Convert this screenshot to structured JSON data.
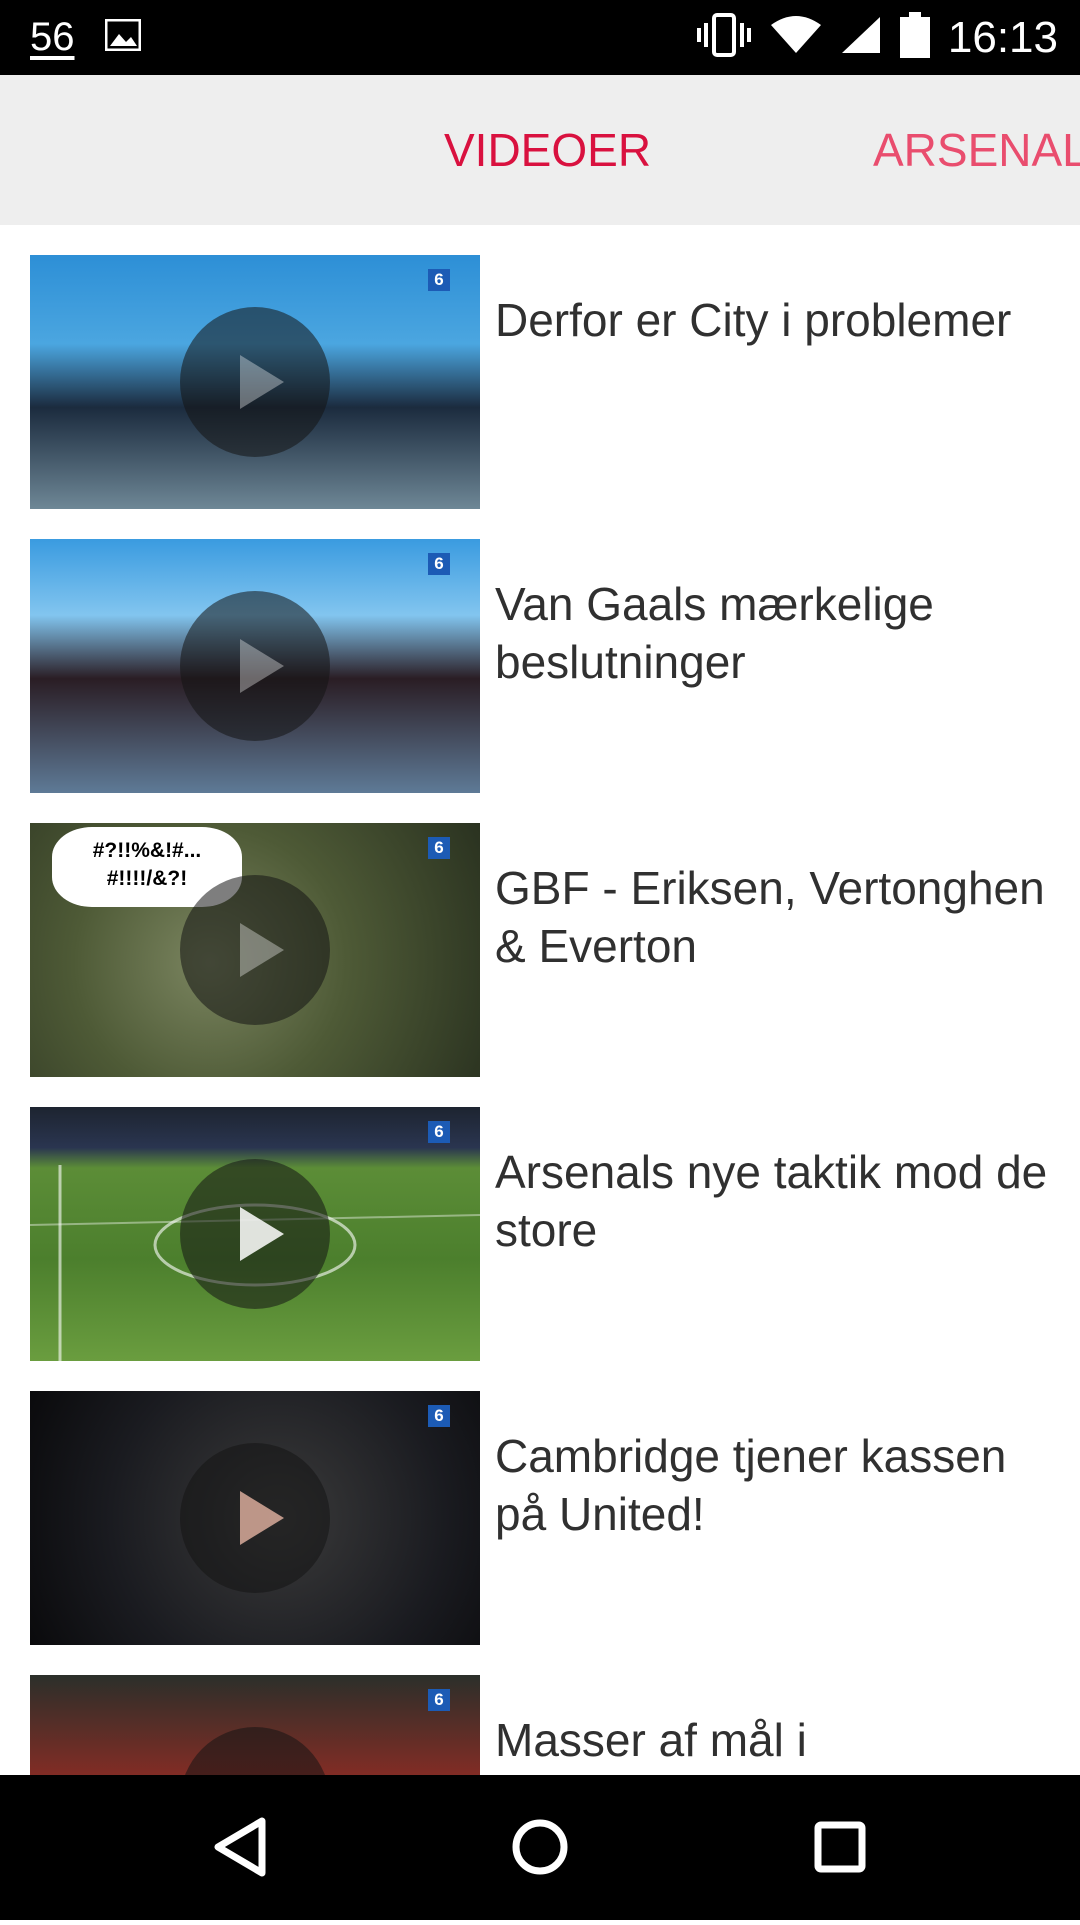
{
  "status_bar": {
    "notification_count": "56",
    "time": "16:13",
    "icons": [
      "image-icon",
      "vibrate-icon",
      "wifi-icon",
      "signal-icon",
      "battery-icon"
    ]
  },
  "tabs": [
    {
      "label": "VIDEOER",
      "active": true,
      "color": "#d9113f"
    },
    {
      "label": "ARSENAL",
      "active": false,
      "color": "#e94d6e"
    }
  ],
  "videos": [
    {
      "title": "Derfor er City i problemer",
      "channel_badge": "6"
    },
    {
      "title": "Van Gaals mærkelige beslutninger",
      "channel_badge": "6"
    },
    {
      "title": "GBF - Eriksen, Vertonghen & Everton",
      "channel_badge": "6",
      "bubble_text": "#?!!%&!#... #!!!!/&?!"
    },
    {
      "title": "Arsenals nye taktik mod de store",
      "channel_badge": "6"
    },
    {
      "title": "Cambridge tjener kassen på United!",
      "channel_badge": "6"
    },
    {
      "title": "Masser af mål i",
      "channel_badge": "6"
    }
  ],
  "nav_bar": {
    "icons": [
      "back-icon",
      "home-icon",
      "recents-icon"
    ]
  }
}
